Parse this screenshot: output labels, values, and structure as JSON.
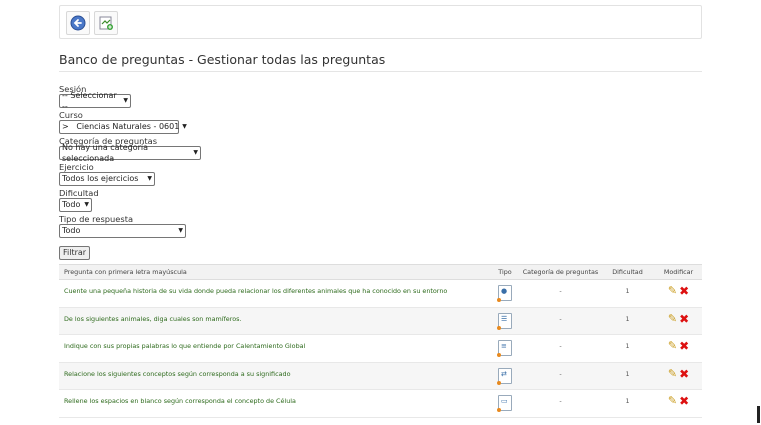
{
  "toolbar": {
    "back_icon": "back-arrow-icon",
    "add_icon": "add-question-icon"
  },
  "page_title": "Banco de preguntas - Gestionar todas las preguntas",
  "filters": {
    "session_label": "Sesión",
    "session_value": "-- Seleccionar --",
    "course_label": "Curso",
    "course_value": ">   Ciencias Naturales - 0601",
    "category_label": "Categoría de preguntas",
    "category_value": "No hay una categoría seleccionada",
    "exercise_label": "Ejercicio",
    "exercise_value": "Todos los ejercicios",
    "difficulty_label": "Dificultad",
    "difficulty_value": "Todo",
    "answer_type_label": "Tipo de respuesta",
    "answer_type_value": "Todo",
    "filter_button": "Filtrar"
  },
  "table": {
    "headers": {
      "question": "Pregunta con primera letra mayúscula",
      "type": "Tipo",
      "category": "Categoría de preguntas",
      "difficulty": "Dificultad",
      "modify": "Modificar"
    },
    "rows": [
      {
        "question": "Cuente una pequeña historia de su vida donde pueda relacionar los diferentes animales que ha conocido en su entorno",
        "category": "-",
        "difficulty": "1",
        "type_icon": "open-answer-icon"
      },
      {
        "question": "De los siguientes animales, diga cuales son mamíferos.",
        "category": "-",
        "difficulty": "1",
        "type_icon": "multiple-answer-icon"
      },
      {
        "question": "Indique con sus propias palabras lo que entiende por Calentamiento Global",
        "category": "-",
        "difficulty": "1",
        "type_icon": "free-answer-icon"
      },
      {
        "question": "Relacione los siguientes conceptos según corresponda a su significado",
        "category": "-",
        "difficulty": "1",
        "type_icon": "matching-icon"
      },
      {
        "question": "Rellene los espacios en blanco según corresponda el concepto de Célula",
        "category": "-",
        "difficulty": "1",
        "type_icon": "fill-blanks-icon"
      }
    ]
  },
  "colors": {
    "question_text": "#2d6a1c",
    "edit_icon": "#c99a1a",
    "delete_icon": "#dd1111",
    "type_dot": "#e88a1f"
  }
}
